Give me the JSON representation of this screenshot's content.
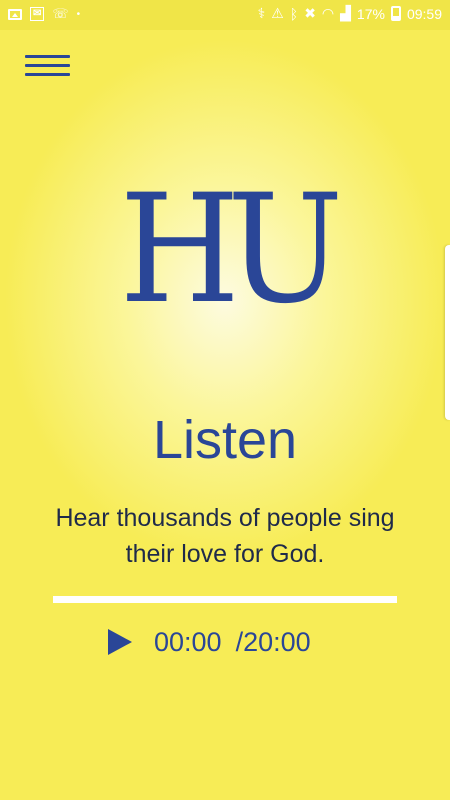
{
  "status_bar": {
    "battery_percent": "17%",
    "time": "09:59",
    "icons": [
      "image-icon",
      "sms-icon",
      "missed-call-icon",
      "dot-icon",
      "battery-saver-icon",
      "alarm-icon",
      "bluetooth-icon",
      "mute-icon",
      "wifi-icon",
      "signal-icon",
      "battery-icon"
    ]
  },
  "header": {
    "menu_icon": "hamburger-menu-icon"
  },
  "logo": {
    "text": "HU"
  },
  "main": {
    "title": "Listen",
    "description": "Hear thousands of people sing their love for God."
  },
  "player": {
    "current_time": "00:00",
    "separator": "/",
    "total_time": "20:00",
    "progress": 0,
    "play_icon": "play-icon"
  },
  "colors": {
    "brand_blue": "#2a4697",
    "background_yellow": "#f7ec56",
    "track_white": "#ffffff"
  }
}
